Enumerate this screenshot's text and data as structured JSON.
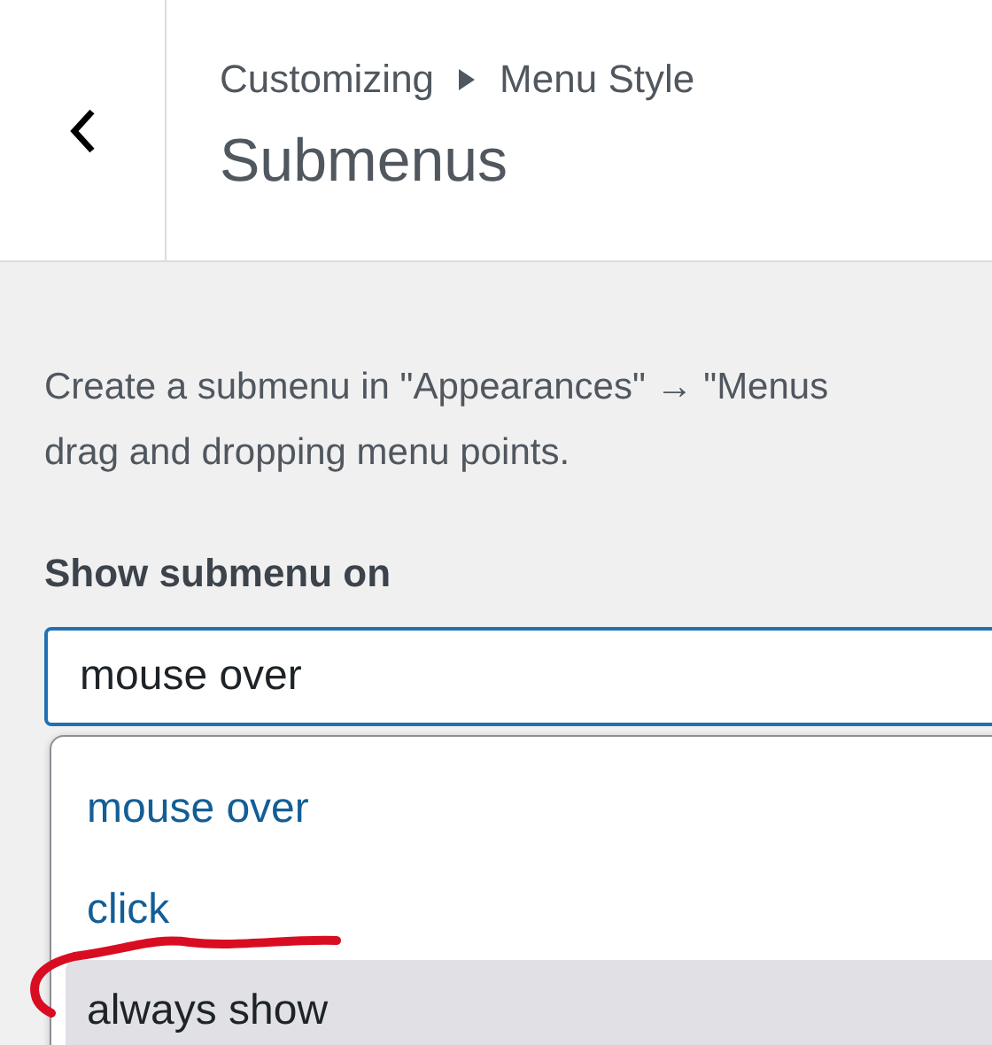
{
  "header": {
    "breadcrumb": [
      "Customizing",
      "Menu Style"
    ],
    "title": "Submenus"
  },
  "description": "Create a submenu in \"Appearances\" → \"Menus",
  "description_line2": "drag and dropping menu points.",
  "field": {
    "label": "Show submenu on",
    "value": "mouse over"
  },
  "dropdown": {
    "options": [
      {
        "label": "mouse over",
        "selected": false
      },
      {
        "label": "click",
        "selected": false
      },
      {
        "label": "always show",
        "selected": true
      }
    ]
  },
  "annotation": {
    "kind": "stroke",
    "color": "#d90d22"
  }
}
